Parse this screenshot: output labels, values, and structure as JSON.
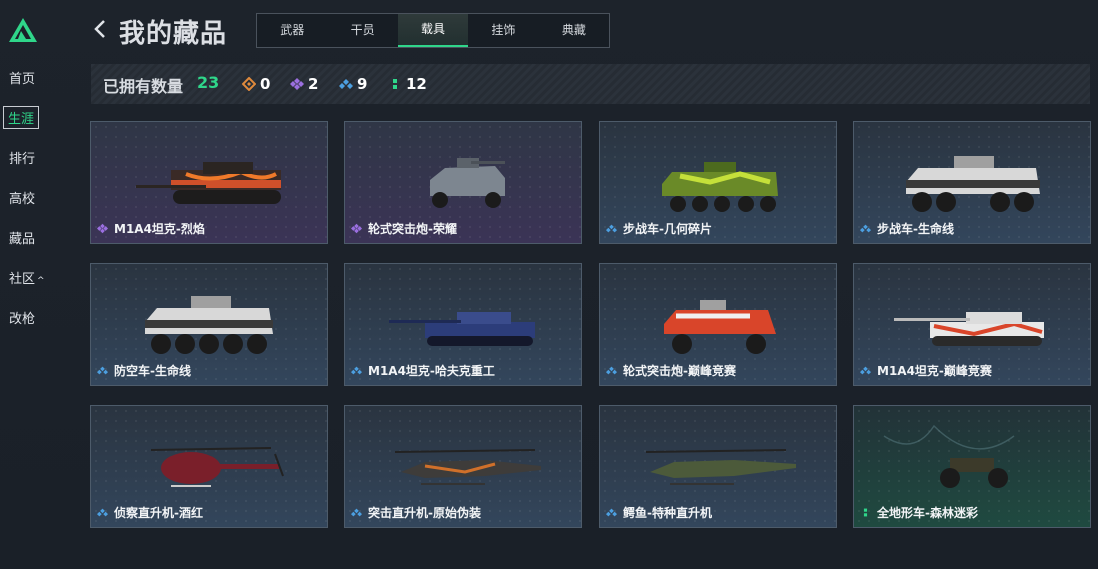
{
  "sidebar": {
    "items": [
      {
        "label": "首页"
      },
      {
        "label": "生涯"
      },
      {
        "label": "排行"
      },
      {
        "label": "高校"
      },
      {
        "label": "藏品"
      },
      {
        "label": "社区"
      },
      {
        "label": "改枪"
      }
    ]
  },
  "header": {
    "title": "我的藏品",
    "tabs": [
      {
        "label": "武器"
      },
      {
        "label": "干员"
      },
      {
        "label": "载具"
      },
      {
        "label": "挂饰"
      },
      {
        "label": "典藏"
      }
    ],
    "active_tab": "载具"
  },
  "owned": {
    "label": "已拥有数量",
    "count": "23",
    "rarities": [
      {
        "icon": "orange-diamond-icon",
        "color": "#e08a3c",
        "count": "0"
      },
      {
        "icon": "purple-diamond-icon",
        "color": "#9b6fe0",
        "count": "2"
      },
      {
        "icon": "blue-diamond-icon",
        "color": "#4c9fe0",
        "count": "9"
      },
      {
        "icon": "green-dots-icon",
        "color": "#2fd68a",
        "count": "12"
      }
    ]
  },
  "colors": {
    "accent": "#2fd68a",
    "purple": "#9b6fe0",
    "blue": "#4c9fe0",
    "green": "#2fd68a"
  },
  "items": [
    {
      "name": "M1A4坦克-烈焰",
      "rarity": "purple"
    },
    {
      "name": "轮式突击炮-荣耀",
      "rarity": "purple"
    },
    {
      "name": "步战车-几何碎片",
      "rarity": "blue"
    },
    {
      "name": "步战车-生命线",
      "rarity": "blue"
    },
    {
      "name": "防空车-生命线",
      "rarity": "blue"
    },
    {
      "name": "M1A4坦克-哈夫克重工",
      "rarity": "blue"
    },
    {
      "name": "轮式突击炮-巅峰竞赛",
      "rarity": "blue"
    },
    {
      "name": "M1A4坦克-巅峰竞赛",
      "rarity": "blue"
    },
    {
      "name": "侦察直升机-酒红",
      "rarity": "blue"
    },
    {
      "name": "突击直升机-原始伪装",
      "rarity": "blue"
    },
    {
      "name": "鳄鱼-特种直升机",
      "rarity": "blue"
    },
    {
      "name": "全地形车-森林迷彩",
      "rarity": "green"
    }
  ]
}
